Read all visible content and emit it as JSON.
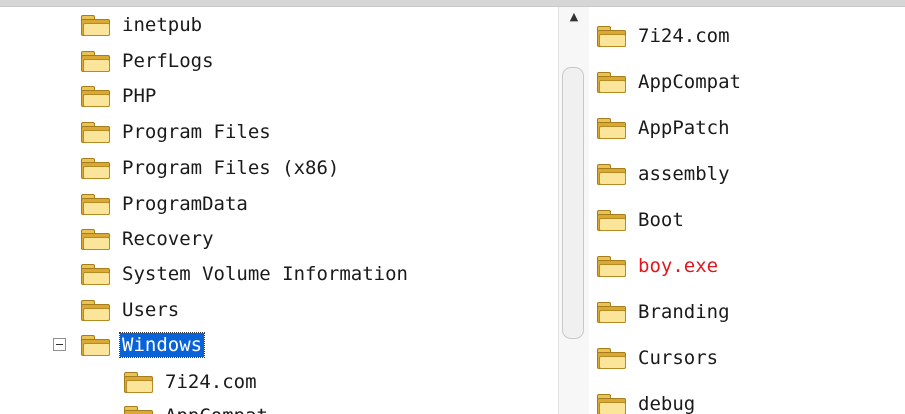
{
  "tree": {
    "items": [
      {
        "label": "inetpub"
      },
      {
        "label": "PerfLogs"
      },
      {
        "label": "PHP"
      },
      {
        "label": "Program Files"
      },
      {
        "label": "Program Files (x86)"
      },
      {
        "label": "ProgramData"
      },
      {
        "label": "Recovery"
      },
      {
        "label": "System Volume Information"
      },
      {
        "label": "Users"
      },
      {
        "label": "Windows",
        "selected": true,
        "expanded": true
      },
      {
        "label": "7i24.com"
      },
      {
        "label": "AppCompat"
      }
    ]
  },
  "scrollbar": {
    "up_arrow": "▲"
  },
  "contents": {
    "items": [
      {
        "label": "7i24.com"
      },
      {
        "label": "AppCompat"
      },
      {
        "label": "AppPatch"
      },
      {
        "label": "assembly"
      },
      {
        "label": "Boot"
      },
      {
        "label": "boy.exe",
        "color": "#e0181d"
      },
      {
        "label": "Branding"
      },
      {
        "label": "Cursors"
      },
      {
        "label": "debug"
      }
    ]
  },
  "colors": {
    "selection": "#0a63d6",
    "highlight_text": "#e0181d",
    "folder": "#e8c454"
  }
}
